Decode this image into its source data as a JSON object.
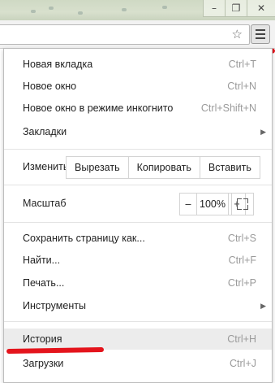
{
  "window": {
    "minimize_glyph": "–",
    "restore_glyph": "❐",
    "close_glyph": "✕"
  },
  "toolbar": {
    "bookmark_star": "☆"
  },
  "menu": {
    "items": [
      {
        "label": "Новая вкладка",
        "shortcut": "Ctrl+T"
      },
      {
        "label": "Новое окно",
        "shortcut": "Ctrl+N"
      },
      {
        "label": "Новое окно в режиме инкогнито",
        "shortcut": "Ctrl+Shift+N"
      },
      {
        "label": "Закладки",
        "shortcut": "",
        "arrow": "▶"
      }
    ],
    "edit": {
      "label": "Изменить",
      "cut": "Вырезать",
      "copy": "Копировать",
      "paste": "Вставить"
    },
    "zoom": {
      "label": "Масштаб",
      "minus": "–",
      "value": "100%",
      "plus": "+"
    },
    "items2": [
      {
        "label": "Сохранить страницу как...",
        "shortcut": "Ctrl+S"
      },
      {
        "label": "Найти...",
        "shortcut": "Ctrl+F"
      },
      {
        "label": "Печать...",
        "shortcut": "Ctrl+P"
      },
      {
        "label": "Инструменты",
        "shortcut": "",
        "arrow": "▶"
      }
    ],
    "items3": [
      {
        "label": "История",
        "shortcut": "Ctrl+H"
      },
      {
        "label": "Загрузки",
        "shortcut": "Ctrl+J"
      }
    ]
  },
  "colors": {
    "annotation_red": "#e4141c",
    "highlight": "#ececec"
  }
}
